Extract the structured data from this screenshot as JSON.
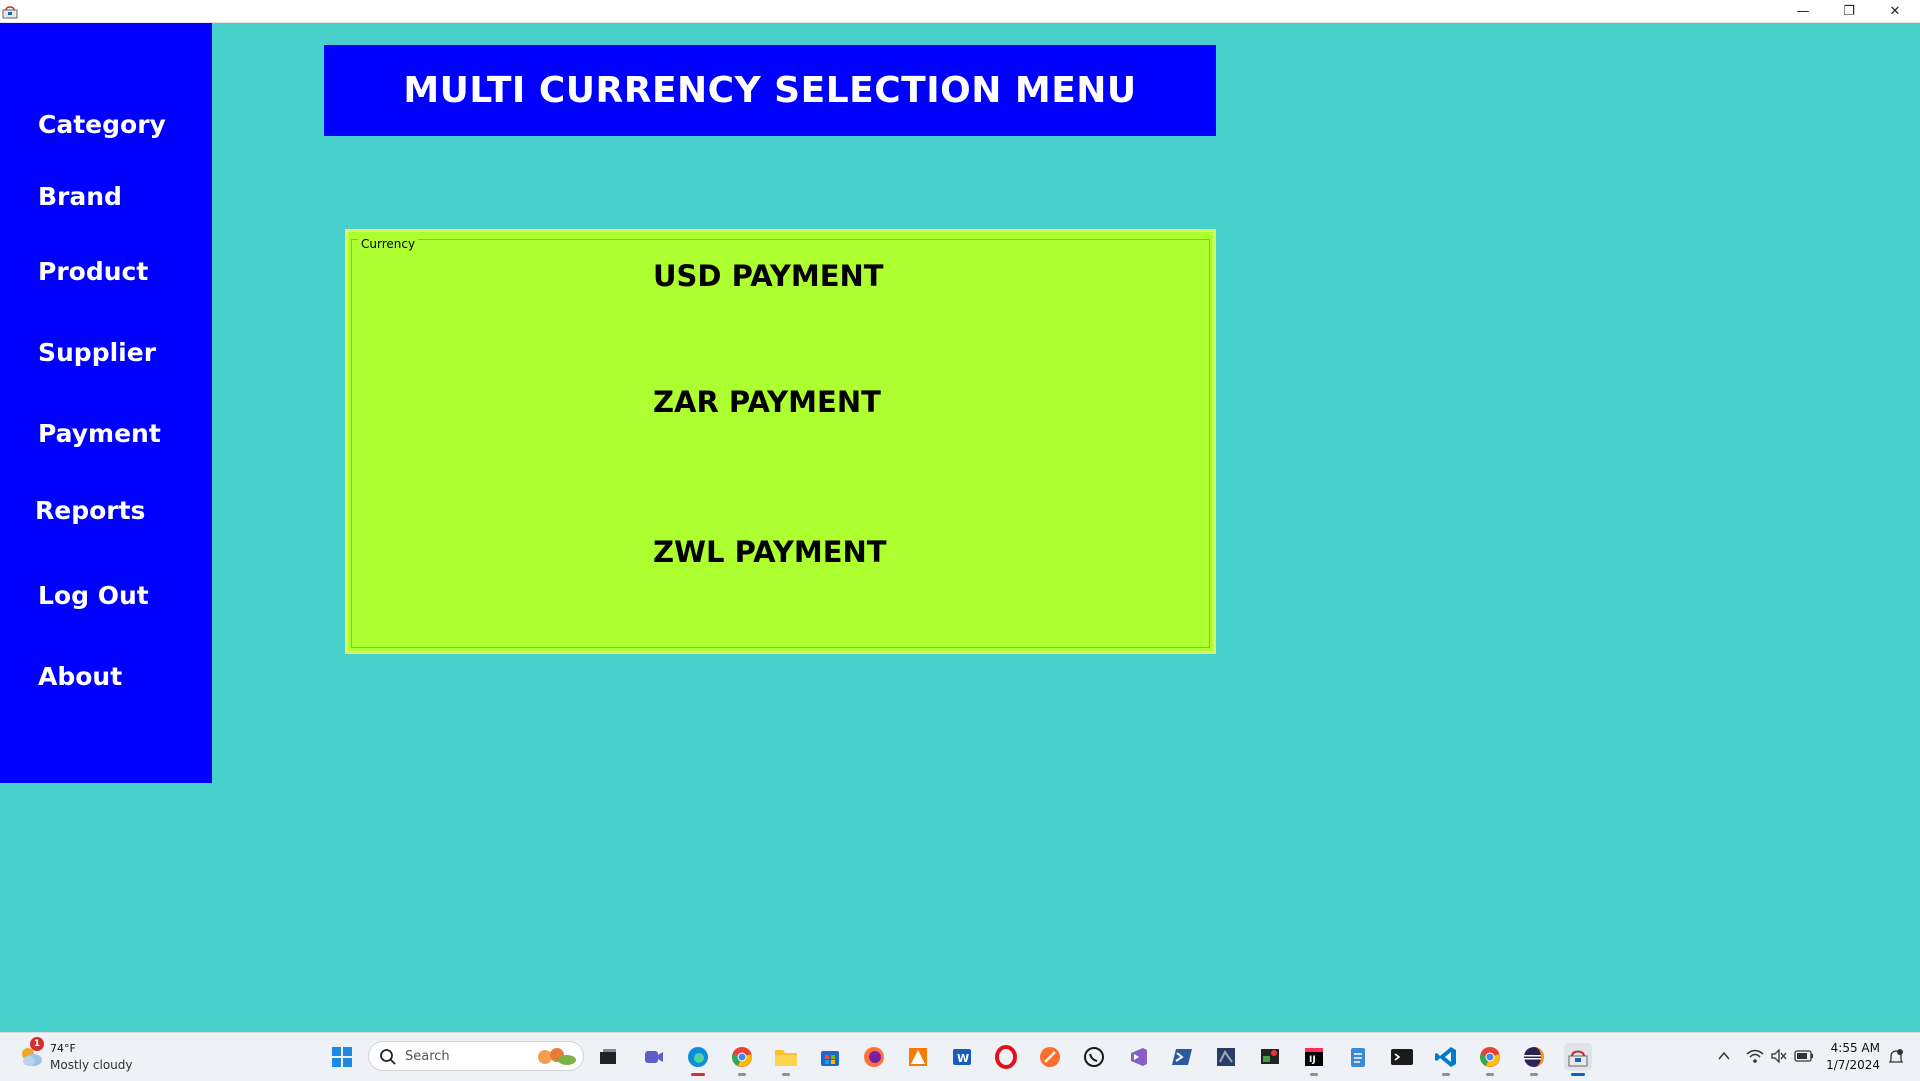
{
  "window": {
    "minimize_symbol": "—",
    "maximize_symbol": "❐",
    "close_symbol": "✕"
  },
  "sidebar": {
    "items": [
      {
        "label": "Category"
      },
      {
        "label": "Brand"
      },
      {
        "label": "Product"
      },
      {
        "label": "Supplier"
      },
      {
        "label": "Payment"
      },
      {
        "label": "Reports"
      },
      {
        "label": "Log Out"
      },
      {
        "label": "About"
      }
    ]
  },
  "header": {
    "title": "MULTI CURRENCY SELECTION MENU"
  },
  "currency_panel": {
    "legend": "Currency",
    "buttons": [
      {
        "label": "USD PAYMENT"
      },
      {
        "label": "ZAR PAYMENT"
      },
      {
        "label": "ZWL PAYMENT"
      }
    ]
  },
  "taskbar": {
    "weather": {
      "temperature": "74°F",
      "condition": "Mostly cloudy",
      "badge": "1"
    },
    "search": {
      "placeholder": "Search"
    },
    "pinned_apps": [
      "task-view",
      "teams-meet",
      "edge",
      "chrome",
      "file-explorer",
      "microsoft-store",
      "firefox",
      "office",
      "word",
      "opera",
      "app-orange",
      "whatsapp",
      "visual-studio",
      "powershell",
      "sql-tool",
      "snipping",
      "intellij",
      "notepad",
      "terminal",
      "vscode",
      "chrome-alt",
      "eclipse",
      "java-app"
    ],
    "clock": {
      "time": "4:55 AM",
      "date": "1/7/2024"
    }
  },
  "colors": {
    "background": "#48d1cc",
    "sidebar": "#0000ff",
    "banner": "#0000ff",
    "panel": "#adff2f"
  }
}
